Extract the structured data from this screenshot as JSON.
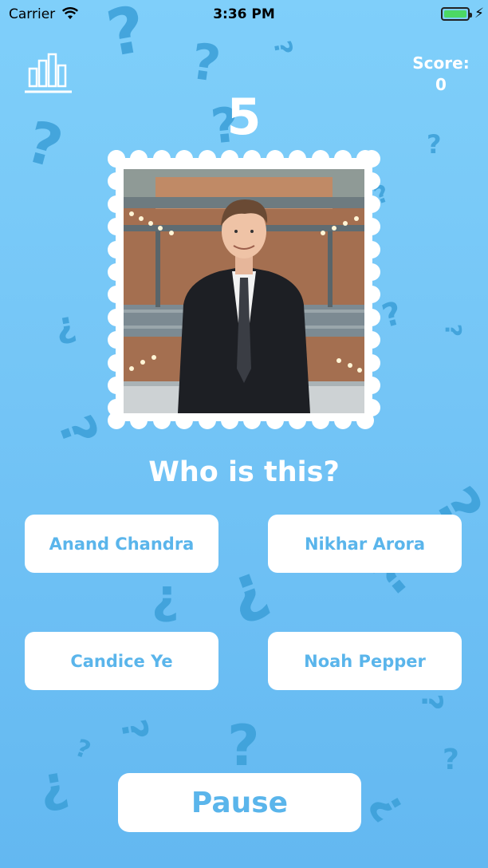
{
  "status_bar": {
    "carrier": "Carrier",
    "time": "3:36 PM",
    "battery_level": 1.0,
    "icons": [
      "wifi-icon",
      "battery-icon",
      "charging-bolt-icon"
    ]
  },
  "header": {
    "stats_icon": "bar-chart-icon",
    "score_label": "Score:",
    "score_value": "0",
    "countdown": "5"
  },
  "question": {
    "prompt": "Who is this?",
    "photo_icon": "person-photo"
  },
  "answers": [
    {
      "label": "Anand Chandra"
    },
    {
      "label": "Nikhar Arora"
    },
    {
      "label": "Candice Ye"
    },
    {
      "label": "Noah Pepper"
    }
  ],
  "footer": {
    "pause_label": "Pause"
  },
  "colors": {
    "background_top": "#7fcffa",
    "background_bottom": "#63b8f1",
    "accent_text": "#5ab5eb",
    "question_mark": "#3b9fd8"
  }
}
